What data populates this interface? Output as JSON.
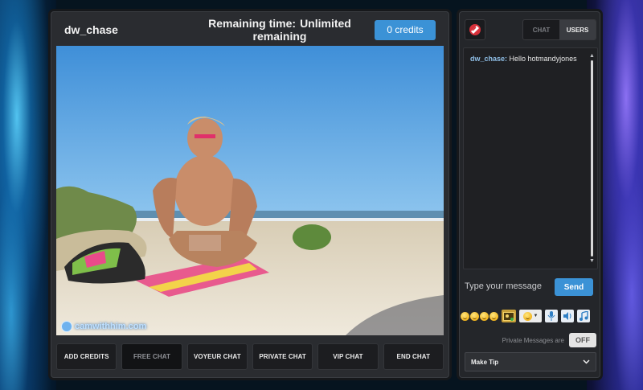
{
  "header": {
    "username": "dw_chase",
    "remaining_label": "Remaining time:",
    "remaining_value": "Unlimited remaining",
    "credits_button": "0 credits"
  },
  "video": {
    "logo_text": "camwithhim.com"
  },
  "actions": [
    {
      "label": "ADD CREDITS",
      "active": false
    },
    {
      "label": "FREE CHAT",
      "active": true
    },
    {
      "label": "VOYEUR CHAT",
      "active": false
    },
    {
      "label": "PRIVATE CHAT",
      "active": false
    },
    {
      "label": "VIP CHAT",
      "active": false
    },
    {
      "label": "END CHAT",
      "active": false
    }
  ],
  "sidebar": {
    "tabs": [
      {
        "label": "CHAT",
        "active": false
      },
      {
        "label": "USERS",
        "active": true
      }
    ],
    "chat_messages": [
      {
        "sender": "dw_chase:",
        "text": "Hello hotmandyjones"
      }
    ],
    "message_placeholder": "Type your message",
    "send_label": "Send",
    "private_messages_label": "Private Messages are",
    "private_messages_state": "OFF",
    "tip_select": "Make Tip",
    "icons": [
      "tip-icon",
      "photo-icon",
      "emoji-dropdown-icon",
      "microphone-icon",
      "speaker-icon",
      "music-icon"
    ]
  },
  "colors": {
    "accent_blue": "#3b92d6",
    "panel": "#2a2c30",
    "chat_sender": "#8fbee6"
  }
}
